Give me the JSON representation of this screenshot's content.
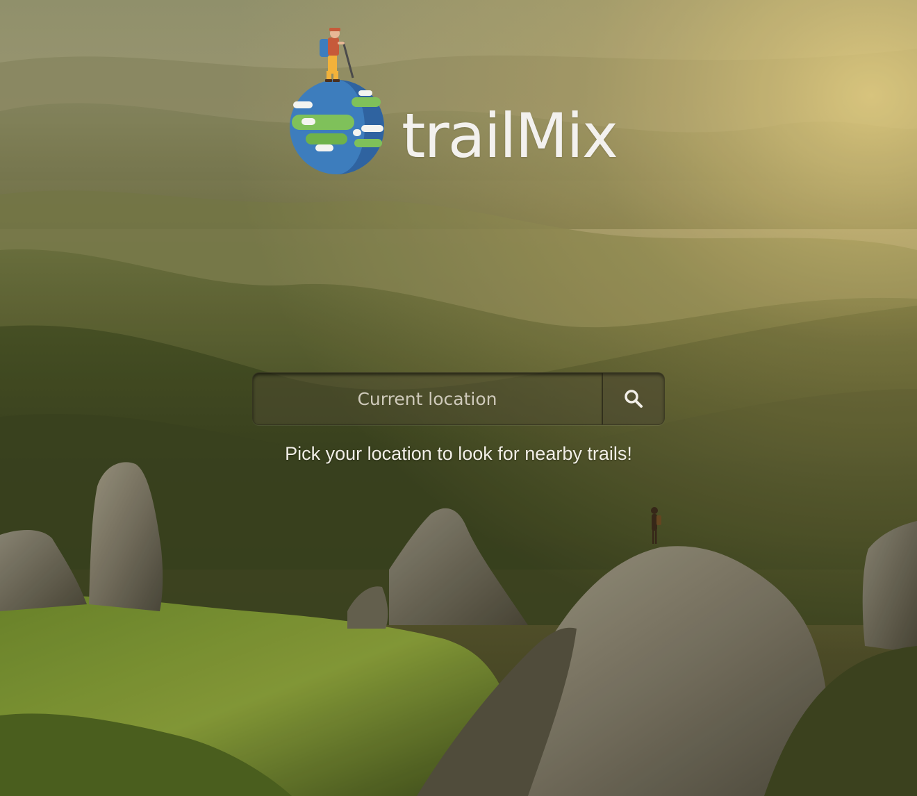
{
  "brand": {
    "name": "trailMix",
    "logo_icon": "globe-with-hiker-icon"
  },
  "search": {
    "placeholder": "Current location",
    "value": "",
    "button_icon": "search-icon"
  },
  "helper_text": "Pick your location to look for nearby trails!",
  "colors": {
    "brand_text": "#f3f1ee",
    "globe_ocean": "#3d7dbd",
    "globe_land": "#7fc15a",
    "backdrop_sky": "#c9b97a",
    "backdrop_forest": "#3f4a22"
  }
}
